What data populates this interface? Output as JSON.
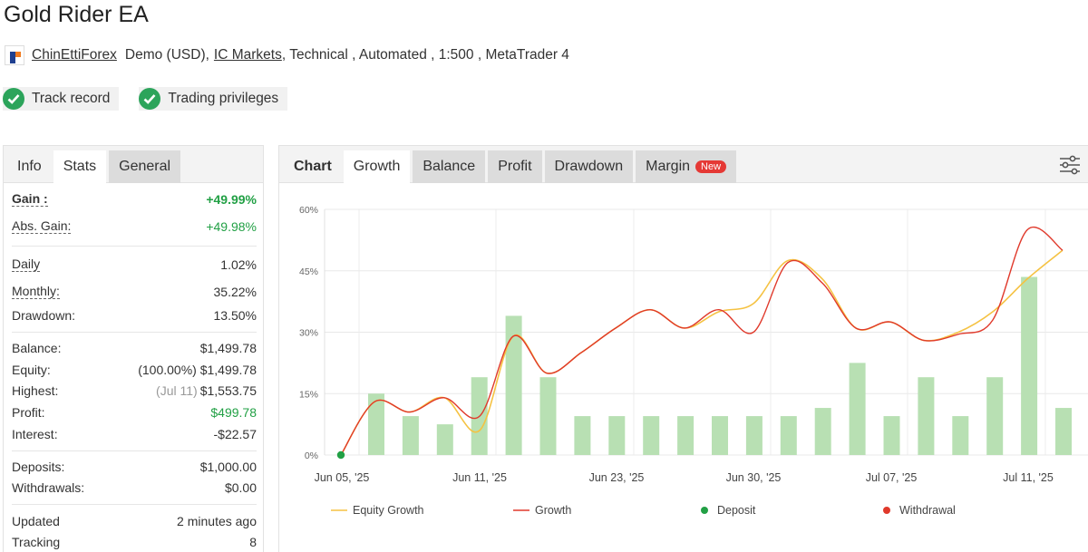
{
  "title": "Gold Rider EA",
  "meta": {
    "author": "ChinEttiForex",
    "account": "Demo (USD),",
    "broker": "IC Markets",
    "tail": ", Technical , Automated , 1:500 , MetaTrader 4"
  },
  "badges": [
    {
      "label": "Track record",
      "icon": "check-icon",
      "color": "#2ca45b"
    },
    {
      "label": "Trading privileges",
      "icon": "check-icon",
      "color": "#2ca45b"
    }
  ],
  "left_tabs": [
    "Info",
    "Stats",
    "General"
  ],
  "stats": {
    "gain": {
      "label": "Gain :",
      "value": "+49.99%"
    },
    "abs_gain": {
      "label": "Abs. Gain:",
      "value": "+49.98%"
    },
    "daily": {
      "label": "Daily",
      "value": "1.02%"
    },
    "monthly": {
      "label": "Monthly:",
      "value": "35.22%"
    },
    "drawdown": {
      "label": "Drawdown:",
      "value": "13.50%"
    },
    "balance": {
      "label": "Balance:",
      "value": "$1,499.78"
    },
    "equity": {
      "label": "Equity:",
      "value": "(100.00%) $1,499.78"
    },
    "highest": {
      "label": "Highest:",
      "note": "(Jul 11)",
      "value": "$1,553.75"
    },
    "profit": {
      "label": "Profit:",
      "value": "$499.78"
    },
    "interest": {
      "label": "Interest:",
      "value": "-$22.57"
    },
    "deposits": {
      "label": "Deposits:",
      "value": "$1,000.00"
    },
    "withdrawals": {
      "label": "Withdrawals:",
      "value": "$0.00"
    },
    "updated": {
      "label": "Updated",
      "value": "2 minutes ago"
    },
    "tracking": {
      "label": "Tracking",
      "value": "8"
    }
  },
  "chart_tabs": {
    "label": "Chart",
    "tabs": [
      "Growth",
      "Balance",
      "Profit",
      "Drawdown",
      "Margin"
    ],
    "new_badge": "New",
    "settings_icon": "sliders-icon"
  },
  "colors": {
    "positive": "#22a045",
    "equity": "#f5c242",
    "growth": "#e0392b",
    "bars": "#b8e0b3",
    "deposit": "#22a045",
    "withdrawal": "#e0392b"
  },
  "chart_data": {
    "type": "line",
    "y_ticks": [
      "60%",
      "45%",
      "30%",
      "15%",
      "0%"
    ],
    "x_ticks": [
      "Jun 05, '25",
      "Jun 11, '25",
      "Jun 23, '25",
      "Jun 30, '25",
      "Jul 07, '25",
      "Jul 11, '25"
    ],
    "ylim": [
      0,
      60
    ],
    "grid": true,
    "legend_position": "bottom",
    "series": [
      {
        "name": "Equity Growth",
        "values": [
          0,
          13,
          10.5,
          14,
          6,
          29,
          20,
          25,
          31,
          35.5,
          31,
          35,
          37,
          47.5,
          43,
          31,
          32.5,
          28,
          30,
          35,
          43,
          50
        ]
      },
      {
        "name": "Growth",
        "values": [
          0,
          13,
          10.5,
          14,
          9.5,
          29,
          20,
          25,
          31,
          35.5,
          31,
          35.5,
          30,
          47,
          42,
          31,
          32.5,
          28,
          29.5,
          33,
          55,
          50
        ]
      },
      {
        "name": "Deposit",
        "points": [
          {
            "x": "Jun 05, '25",
            "y": 0
          }
        ]
      },
      {
        "name": "Withdrawal",
        "points": []
      }
    ],
    "bars": [
      15,
      9.5,
      7.5,
      19,
      34,
      19,
      9.5,
      9.5,
      9.5,
      9.5,
      9.5,
      9.5,
      9.5,
      11.5,
      22.5,
      9.5,
      19,
      9.5,
      19,
      43.5,
      11.5
    ]
  }
}
